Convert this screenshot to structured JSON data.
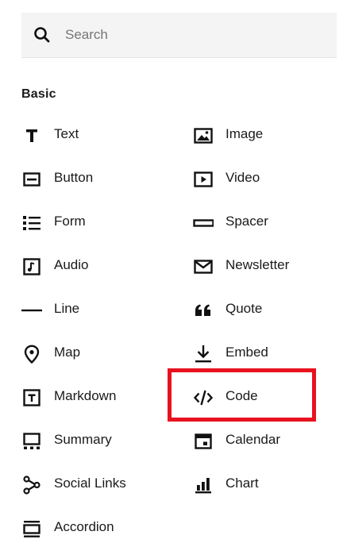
{
  "search": {
    "placeholder": "Search",
    "value": ""
  },
  "section": {
    "title": "Basic"
  },
  "blocks_left": [
    {
      "label": "Text",
      "icon": "text-icon"
    },
    {
      "label": "Button",
      "icon": "button-icon"
    },
    {
      "label": "Form",
      "icon": "form-icon"
    },
    {
      "label": "Audio",
      "icon": "audio-icon"
    },
    {
      "label": "Line",
      "icon": "line-icon"
    },
    {
      "label": "Map",
      "icon": "map-pin-icon"
    },
    {
      "label": "Markdown",
      "icon": "markdown-icon"
    },
    {
      "label": "Summary",
      "icon": "summary-icon"
    },
    {
      "label": "Social Links",
      "icon": "social-links-icon"
    },
    {
      "label": "Accordion",
      "icon": "accordion-icon"
    }
  ],
  "blocks_right": [
    {
      "label": "Image",
      "icon": "image-icon"
    },
    {
      "label": "Video",
      "icon": "video-icon"
    },
    {
      "label": "Spacer",
      "icon": "spacer-icon"
    },
    {
      "label": "Newsletter",
      "icon": "newsletter-icon"
    },
    {
      "label": "Quote",
      "icon": "quote-icon"
    },
    {
      "label": "Embed",
      "icon": "embed-icon"
    },
    {
      "label": "Code",
      "icon": "code-icon"
    },
    {
      "label": "Calendar",
      "icon": "calendar-icon"
    },
    {
      "label": "Chart",
      "icon": "chart-icon"
    }
  ],
  "highlight": {
    "color": "#e8121f",
    "target": "Code"
  }
}
